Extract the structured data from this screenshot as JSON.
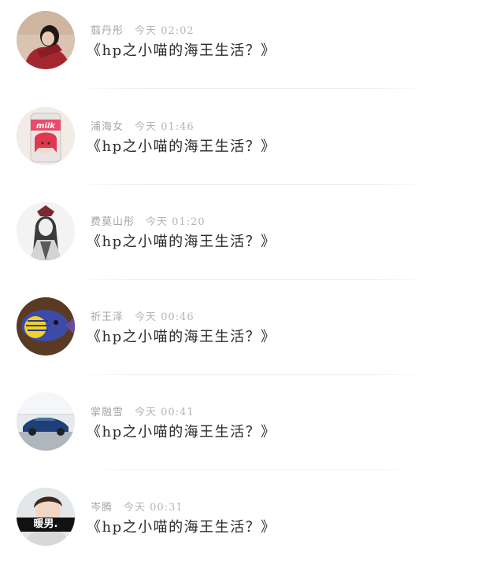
{
  "comments": [
    {
      "username": "翦丹彤",
      "time": "今天 02:02",
      "text": "《hp之小喵的海王生活？》",
      "avatar": "girl-red-sweater-avatar"
    },
    {
      "username": "浦海女",
      "time": "今天 01:46",
      "text": "《hp之小喵的海王生活？》",
      "avatar": "milk-can-avatar"
    },
    {
      "username": "费莫山彤",
      "time": "今天 01:20",
      "text": "《hp之小喵的海王生活？》",
      "avatar": "anime-sketch-avatar"
    },
    {
      "username": "祈王泽",
      "time": "今天 00:46",
      "text": "《hp之小喵的海王生活？》",
      "avatar": "fish-avatar"
    },
    {
      "username": "掌融雪",
      "time": "今天 00:41",
      "text": "《hp之小喵的海王生活？》",
      "avatar": "sports-car-avatar"
    },
    {
      "username": "岑腾",
      "time": "今天 00:31",
      "text": "《hp之小喵的海王生活？》",
      "avatar": "boy-portrait-avatar",
      "avatar_caption": "暖男."
    }
  ]
}
